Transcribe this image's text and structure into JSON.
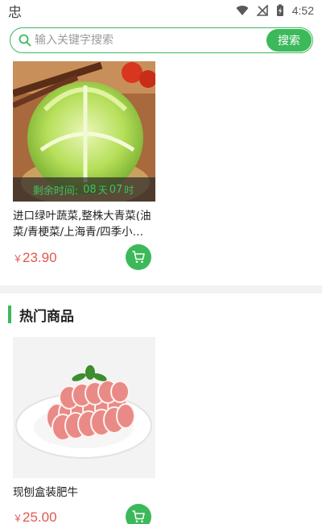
{
  "status_bar": {
    "app_glyph": "忠",
    "time": "4:52",
    "icons": [
      "wifi-icon",
      "no-signal-icon",
      "battery-charging-icon"
    ]
  },
  "search": {
    "placeholder": "输入关键字搜索",
    "button_label": "搜索",
    "accent_color": "#3cb95a"
  },
  "flash_product": {
    "countdown_label": "剩余时间:",
    "countdown_days": "08",
    "countdown_day_unit": "天",
    "countdown_hours": "07",
    "countdown_hour_unit": "时",
    "name": "进口绿叶蔬菜,整株大青菜(油菜/青梗菜/上海青/四季小…",
    "currency": "￥",
    "price": "23.90",
    "image": "lettuce-photo"
  },
  "hot_section": {
    "title": "热门商品",
    "products": [
      {
        "name": "现刨盒装肥牛",
        "currency": "￥",
        "price": "25.00",
        "image": "sliced-beef-photo"
      }
    ]
  },
  "colors": {
    "primary_green": "#3cb95a",
    "price_red": "#e0584f"
  }
}
